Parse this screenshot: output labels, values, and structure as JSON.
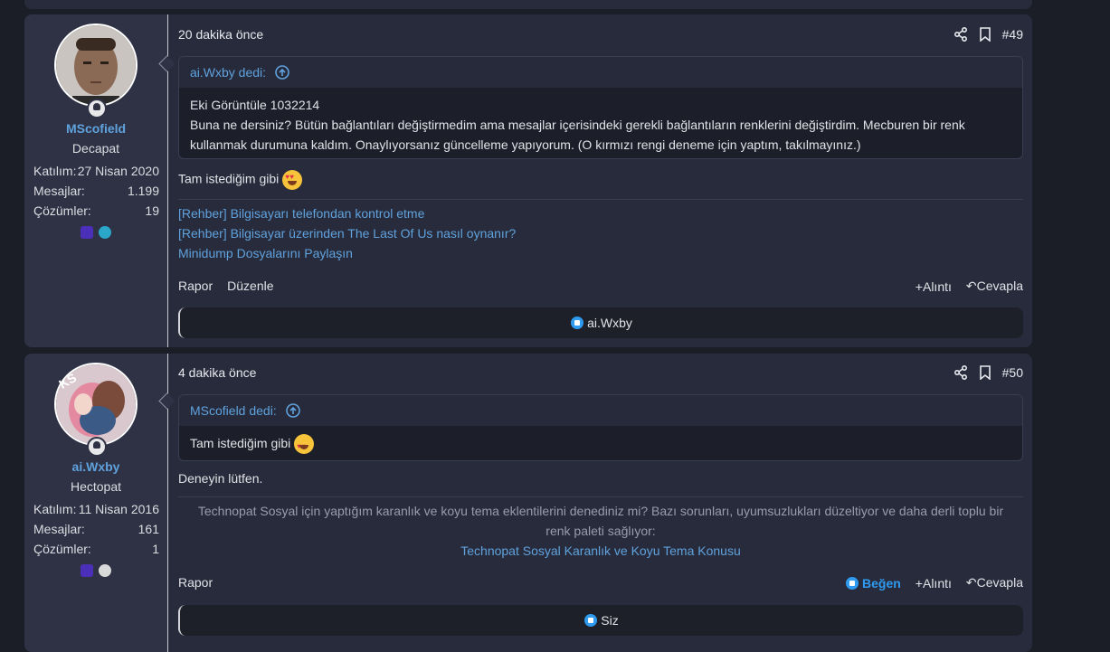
{
  "posts": [
    {
      "user": {
        "name": "MScofield",
        "title": "Decapat",
        "joined_label": "Katılım:",
        "joined": "27 Nisan 2020",
        "messages_label": "Mesajlar:",
        "messages": "1.199",
        "solutions_label": "Çözümler:",
        "solutions": "19"
      },
      "time": "20 dakika önce",
      "number": "#49",
      "quote": {
        "author": "ai.Wxby dedi:",
        "line1": "Eki Görüntüle 1032214",
        "line2": "Buna ne dersiniz? Bütün bağlantıları değiştirmedim ama mesajlar içerisindeki gerekli bağlantıların renklerini değiştirdim. Mecburen bir renk kullanmak durumuna kaldım. Onaylıyorsanız güncelleme yapıyorum. (O kırmızı rengi deneme için yaptım, takılmayınız.)"
      },
      "body": "Tam istediğim gibi",
      "links": [
        "[Rehber] Bilgisayarı telefondan kontrol etme",
        "[Rehber] Bilgisayar üzerinden The Last Of Us nasıl oynanır?",
        "Minidump Dosyalarını Paylaşın"
      ],
      "actions": {
        "report": "Rapor",
        "edit": "Düzenle",
        "quote": "Alıntı",
        "reply": "Cevapla"
      },
      "reaction": "ai.Wxby"
    },
    {
      "user": {
        "name": "ai.Wxby",
        "title": "Hectopat",
        "joined_label": "Katılım:",
        "joined": "11 Nisan 2016",
        "messages_label": "Mesajlar:",
        "messages": "161",
        "solutions_label": "Çözümler:",
        "solutions": "1",
        "avatar_text": "KS"
      },
      "time": "4 dakika önce",
      "number": "#50",
      "quote": {
        "author": "MScofield dedi:",
        "line1": "Tam istediğim gibi"
      },
      "body": "Deneyin lütfen.",
      "signature": {
        "text": "Technopat Sosyal için yaptığım karanlık ve koyu tema eklentilerini denediniz mi? Bazı sorunları, uyumsuzlukları düzeltiyor ve daha derli toplu bir renk paleti sağlıyor:",
        "link": "Technopat Sosyal Karanlık ve Koyu Tema Konusu"
      },
      "actions": {
        "report": "Rapor",
        "like": "Beğen",
        "quote": "Alıntı",
        "reply": "Cevapla"
      },
      "reaction": "Siz"
    }
  ],
  "colors": {
    "accent": "#5fa2dd",
    "like": "#2f9bf0",
    "panel": "#282b3b",
    "background": "#1b1e27"
  }
}
